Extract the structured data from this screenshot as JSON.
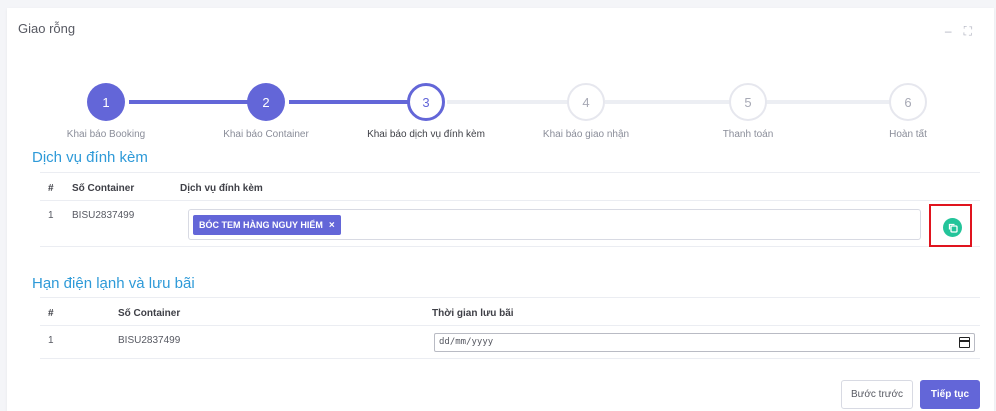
{
  "card": {
    "title": "Giao rỗng",
    "controls": [
      "–",
      "⛶"
    ]
  },
  "steps": [
    {
      "num": "1",
      "label": "Khai báo Booking",
      "state": "done"
    },
    {
      "num": "2",
      "label": "Khai báo Container",
      "state": "done"
    },
    {
      "num": "3",
      "label": "Khai báo dịch vụ đính kèm",
      "state": "current"
    },
    {
      "num": "4",
      "label": "Khai báo giao nhận",
      "state": "todo"
    },
    {
      "num": "5",
      "label": "Thanh toán",
      "state": "todo"
    },
    {
      "num": "6",
      "label": "Hoàn tất",
      "state": "todo"
    }
  ],
  "services": {
    "title": "Dịch vụ đính kèm",
    "headers": {
      "idx": "#",
      "container": "Số Container",
      "service": "Dịch vụ đính kèm"
    },
    "rows": [
      {
        "idx": "1",
        "container": "BISU2837499",
        "tag": "BÓC TEM HÀNG NGUY HIỂM",
        "tag_remove": "×"
      }
    ]
  },
  "storage": {
    "title": "Hạn điện lạnh và lưu bãi",
    "headers": {
      "idx": "#",
      "container": "Số Container",
      "time": "Thời gian lưu bãi"
    },
    "rows": [
      {
        "idx": "1",
        "container": "BISU2837499",
        "date_placeholder": "dd/mm/yyyy"
      }
    ]
  },
  "buttons": {
    "prev": "Bước trước",
    "next": "Tiếp tục"
  },
  "colors": {
    "accent": "#6366d8",
    "section": "#2e9ad8",
    "copy": "#23c49a",
    "highlight": "#e0141e"
  }
}
